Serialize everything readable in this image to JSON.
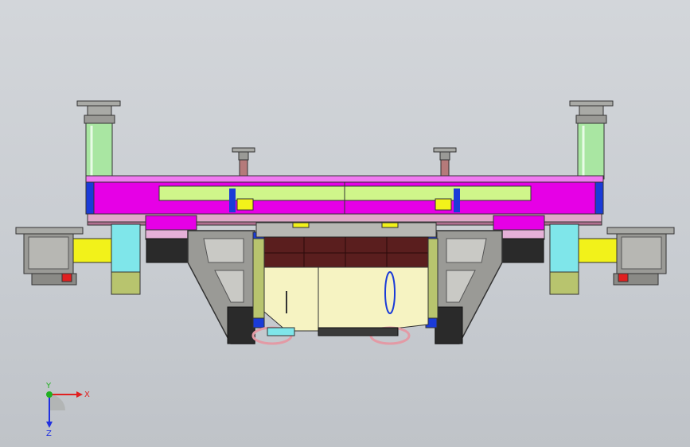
{
  "viewport": {
    "background": "#c8ccd1"
  },
  "colors": {
    "magenta": "#e600e6",
    "magenta_dark": "#9a009a",
    "lime": "#cff58a",
    "green": "#a9e6a2",
    "gray": "#9a9a96",
    "gray_dark": "#5a5a58",
    "yellow": "#f2f21a",
    "cyan": "#7fe6ea",
    "blue": "#1a3bd8",
    "maroon": "#5a1e1e",
    "cream": "#f6f3c2",
    "pink": "#e39aa5",
    "olive": "#b8c46e"
  },
  "triad": {
    "x_label": "X",
    "y_label": "Y",
    "z_label": "Z",
    "x_color": "#e02020",
    "y_color": "#20b020",
    "z_color": "#2030e0"
  }
}
